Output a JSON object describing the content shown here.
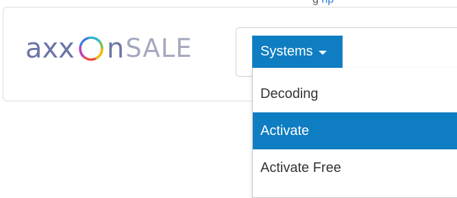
{
  "top_cutoff": {
    "text": "g",
    "link_text": "np"
  },
  "logo": {
    "part1": "axx",
    "part2": "n",
    "part3": "SALE"
  },
  "systems_button": {
    "label": "Systems"
  },
  "dropdown": {
    "items": [
      {
        "label": "Decoding",
        "active": false
      },
      {
        "label": "Activate",
        "active": true
      },
      {
        "label": "Activate Free",
        "active": false
      }
    ]
  },
  "colors": {
    "primary": "#0f7dc2",
    "logo_text": "#6b76a4",
    "logo_sale": "#a5a9bf"
  }
}
